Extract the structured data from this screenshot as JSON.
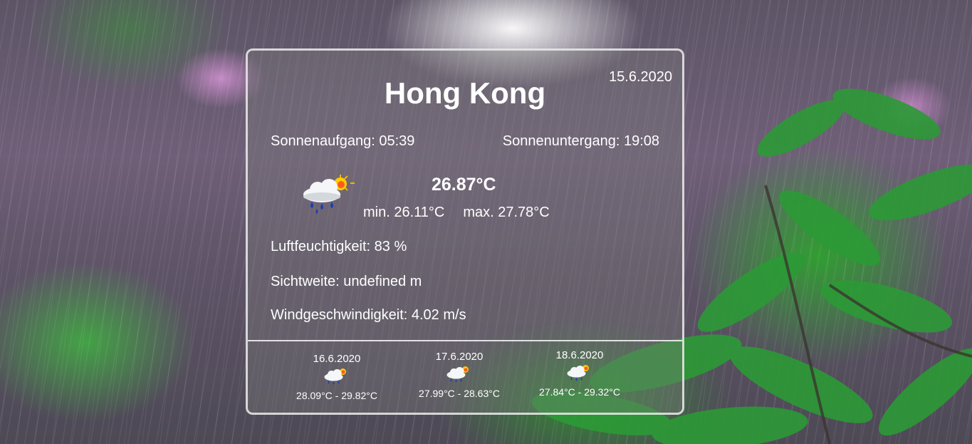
{
  "weather": {
    "date": "15.6.2020",
    "city": "Hong Kong",
    "sunrise": "Sonnenaufgang: 05:39",
    "sunset": "Sonnenuntergang: 19:08",
    "icon": "rain-cloud-sun-icon",
    "temperature": "26.87°C",
    "min": "min. 26.11°C",
    "max": "max. 27.78°C",
    "humidity": "Luftfeuchtigkeit: 83 %",
    "visibility": "Sichtweite: undefined m",
    "wind": "Windgeschwindigkeit: 4.02 m/s"
  },
  "forecast": [
    {
      "date": "16.6.2020",
      "icon": "rain-cloud-sun-icon",
      "range": "28.09°C - 29.82°C"
    },
    {
      "date": "17.6.2020",
      "icon": "rain-cloud-sun-icon",
      "range": "27.99°C - 28.63°C"
    },
    {
      "date": "18.6.2020",
      "icon": "rain-cloud-sun-icon",
      "range": "27.84°C - 29.32°C"
    }
  ]
}
